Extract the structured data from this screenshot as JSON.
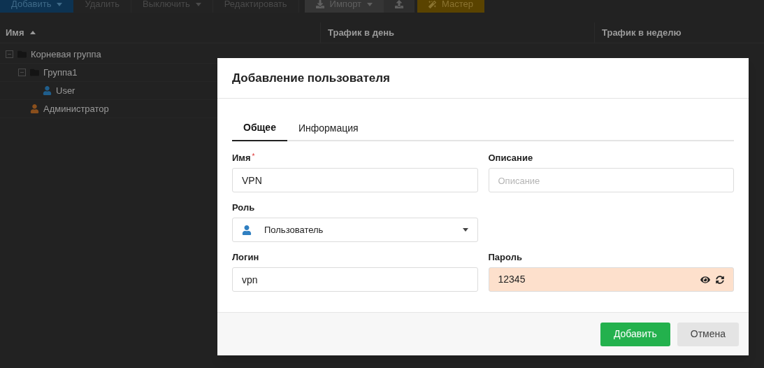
{
  "toolbar": [
    {
      "label": "Добавить",
      "kind": "primary",
      "dropdown": true
    },
    {
      "label": "Удалить",
      "kind": "plain",
      "dropdown": false
    },
    {
      "label": "Выключить",
      "kind": "plain",
      "dropdown": true
    },
    {
      "label": "Редактировать",
      "kind": "plain",
      "dropdown": false
    },
    {
      "label": "Импорт",
      "kind": "import",
      "dropdown": true
    },
    {
      "kind": "upload",
      "dropdown": false
    },
    {
      "label": "Мастер",
      "kind": "wizard",
      "dropdown": false
    }
  ],
  "table": {
    "columns": [
      {
        "label": "Имя",
        "sorted": true
      },
      {
        "label": "Трафик в день",
        "sorted": false
      },
      {
        "label": "Трафик в неделю",
        "sorted": false
      }
    ],
    "tree": [
      {
        "label": "Корневая группа",
        "kind": "group",
        "expanded": true,
        "children": [
          {
            "label": "Группа1",
            "kind": "group",
            "expanded": true,
            "children": [
              {
                "label": "User",
                "kind": "user",
                "color": "#1f5e8c"
              }
            ]
          },
          {
            "label": "Администратор",
            "kind": "user",
            "color": "#8a4f1c"
          }
        ]
      }
    ]
  },
  "dialog": {
    "title": "Добавление пользователя",
    "tabs": [
      {
        "label": "Общее",
        "selected": true
      },
      {
        "label": "Информация",
        "selected": false
      }
    ],
    "fields": [
      {
        "label": "Имя",
        "required_mark": "*",
        "kind": "text",
        "value": "VPN"
      },
      {
        "label": "Описание",
        "kind": "text",
        "placeholder": "Описание"
      },
      {
        "label": "Роль",
        "kind": "select",
        "value": "Пользователь"
      },
      {
        "kind": "empty"
      },
      {
        "label": "Логин",
        "kind": "text",
        "value": "vpn"
      },
      {
        "label": "Пароль",
        "kind": "password",
        "value": "12345",
        "warning": true
      }
    ],
    "buttons": [
      {
        "label": "Добавить",
        "kind": "primary"
      },
      {
        "label": "Отмена",
        "kind": "secondary"
      }
    ]
  }
}
